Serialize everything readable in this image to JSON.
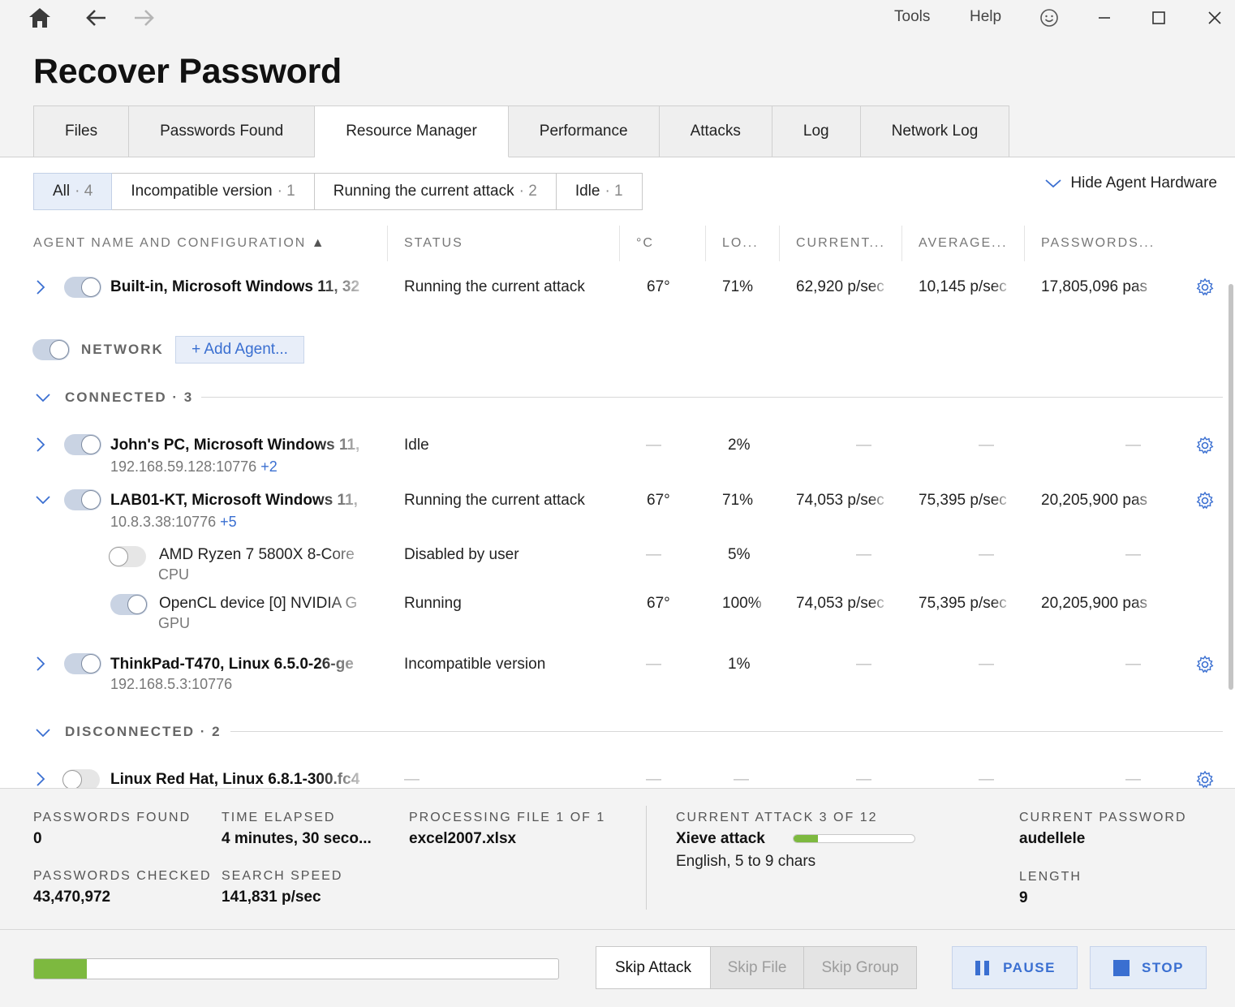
{
  "titlebar": {
    "menu_tools": "Tools",
    "menu_help": "Help",
    "icons": [
      "home-icon",
      "back-arrow-icon",
      "forward-arrow-icon",
      "smiley-icon",
      "minimize-icon",
      "maximize-icon",
      "close-icon"
    ]
  },
  "page": {
    "title": "Recover Password"
  },
  "tabs": [
    {
      "label": "Files"
    },
    {
      "label": "Passwords Found"
    },
    {
      "label": "Resource Manager",
      "active": true
    },
    {
      "label": "Performance"
    },
    {
      "label": "Attacks"
    },
    {
      "label": "Log"
    },
    {
      "label": "Network Log"
    }
  ],
  "filters": [
    {
      "label": "All",
      "count": "· 4",
      "active": true
    },
    {
      "label": "Incompatible version",
      "count": "· 1"
    },
    {
      "label": "Running the current attack",
      "count": "· 2"
    },
    {
      "label": "Idle",
      "count": "· 1"
    }
  ],
  "hide_hardware": "Hide Agent Hardware",
  "columns": {
    "name": "AGENT NAME AND CONFIGURATION",
    "status": "STATUS",
    "temp": "°C",
    "load": "LO...",
    "current": "CURRENT...",
    "average": "AVERAGE...",
    "passwords": "PASSWORDS..."
  },
  "builtin": {
    "name": "Built-in, Microsoft Windows 11, 32",
    "status": "Running the current attack",
    "temp": "67°",
    "load": "71%",
    "current": "62,920 p/sec",
    "average": "10,145 p/sec",
    "passwords": "17,805,096 pas"
  },
  "network": {
    "label": "NETWORK",
    "add_agent": "+ Add Agent..."
  },
  "connected": {
    "label": "CONNECTED · 3",
    "agents": [
      {
        "name": "John's PC, Microsoft Windows 11,",
        "address": "192.168.59.128:10776",
        "extra": "+2",
        "status": "Idle",
        "temp": "—",
        "load": "2%",
        "current": "—",
        "average": "—",
        "passwords": "—"
      },
      {
        "name": "LAB01-KT, Microsoft Windows 11,",
        "address": "10.8.3.38:10776",
        "extra": "+5",
        "status": "Running the current attack",
        "temp": "67°",
        "load": "71%",
        "current": "74,053 p/sec",
        "average": "75,395 p/sec",
        "passwords": "20,205,900 pas"
      },
      {
        "name": "ThinkPad-T470, Linux 6.5.0-26-ge",
        "address": "192.168.5.3:10776",
        "status": "Incompatible version",
        "temp": "—",
        "load": "1%",
        "current": "—",
        "average": "—",
        "passwords": "—"
      }
    ],
    "devices": [
      {
        "name": "AMD Ryzen 7 5800X 8-Core",
        "type": "CPU",
        "status": "Disabled by user",
        "temp": "—",
        "load": "5%",
        "current": "—",
        "average": "—",
        "passwords": "—"
      },
      {
        "name": "OpenCL device [0] NVIDIA G",
        "type": "GPU",
        "status": "Running",
        "temp": "67°",
        "load": "100%",
        "current": "74,053 p/sec",
        "average": "75,395 p/sec",
        "passwords": "20,205,900 pas"
      }
    ]
  },
  "disconnected": {
    "label": "DISCONNECTED · 2",
    "agents": [
      {
        "name": "Linux Red Hat, Linux 6.8.1-300.fc4",
        "status": "—",
        "temp": "—",
        "load": "—",
        "current": "—",
        "average": "—",
        "passwords": "—"
      }
    ]
  },
  "stats": {
    "passwords_found_label": "PASSWORDS FOUND",
    "passwords_found": "0",
    "time_elapsed_label": "TIME ELAPSED",
    "time_elapsed": "4 minutes, 30 seco...",
    "processing_label": "PROCESSING FILE 1 OF 1",
    "processing_file": "excel2007.xlsx",
    "passwords_checked_label": "PASSWORDS CHECKED",
    "passwords_checked": "43,470,972",
    "search_speed_label": "SEARCH SPEED",
    "search_speed": "141,831 p/sec",
    "current_attack_label": "CURRENT ATTACK 3 OF 12",
    "attack_name": "Xieve attack",
    "attack_progress": 0.2,
    "attack_detail": "English, 5 to 9 chars",
    "current_password_label": "CURRENT PASSWORD",
    "current_password": "audellele",
    "length_label": "LENGTH",
    "length": "9"
  },
  "footer": {
    "overall_progress": 0.1,
    "skip_attack": "Skip Attack",
    "skip_file": "Skip File",
    "skip_group": "Skip Group",
    "pause": "PAUSE",
    "stop": "STOP"
  },
  "colors": {
    "accent": "#3a6fd1",
    "progress": "#7db93f"
  }
}
